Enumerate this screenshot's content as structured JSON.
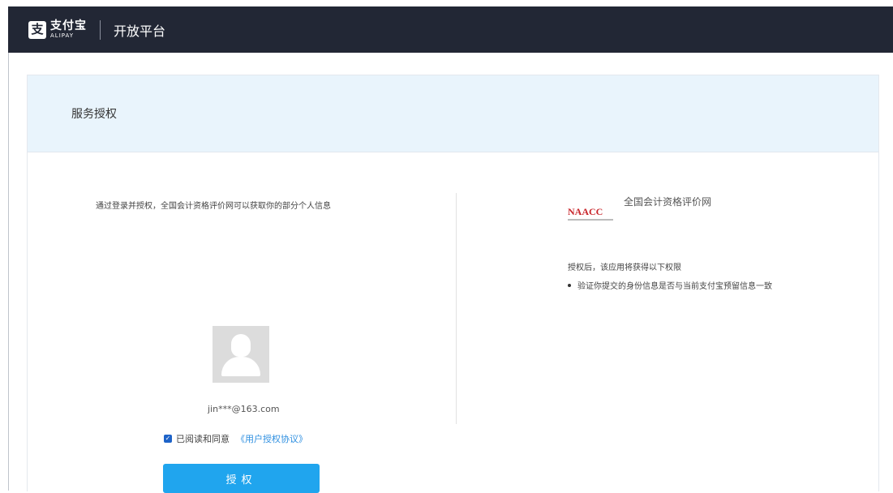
{
  "header": {
    "logo_cn": "支付宝",
    "logo_en": "ALIPAY",
    "platform": "开放平台"
  },
  "card": {
    "title": "服务授权"
  },
  "left": {
    "intro": "通过登录并授权，全国会计资格评价网可以获取你的部分个人信息",
    "email": "jin***@163.com",
    "agree_text": "已阅读和同意",
    "agree_link": "《用户授权协议》",
    "button": "授权",
    "checked": true
  },
  "right": {
    "logo": "NAACC",
    "site_name": "全国会计资格评价网",
    "perm_heading": "授权后，该应用将获得以下权限",
    "permissions": [
      "验证你提交的身份信息是否与当前支付宝预留信息一致"
    ]
  },
  "colors": {
    "topbar": "#222735",
    "header_band": "#e9f4fc",
    "button": "#20a5ee",
    "link": "#2e8fe0",
    "logo_red": "#c8242a"
  }
}
